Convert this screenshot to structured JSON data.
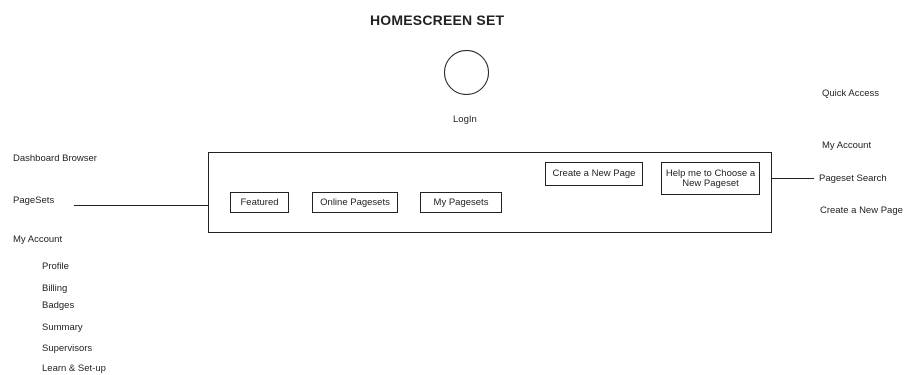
{
  "title": "HOMESCREEN SET",
  "login": {
    "label": "LogIn"
  },
  "left_menu": {
    "dashboard": "Dashboard Browser",
    "pagesets": "PageSets",
    "my_account": "My Account",
    "account_items": [
      "Profile",
      "Billing",
      "Badges",
      "Summary",
      "Supervisors",
      "Learn & Set-up"
    ]
  },
  "panel": {
    "featured": "Featured",
    "online_pagesets": "Online Pagesets",
    "my_pagesets": "My Pagesets",
    "create_new_page": "Create a New Page",
    "help_choose": "Help me to Choose a New Pageset"
  },
  "right_menu": {
    "quick_access": "Quick Access",
    "my_account": "My Account",
    "pageset_search": "Pageset Search",
    "create_new_page": "Create a New Page"
  }
}
